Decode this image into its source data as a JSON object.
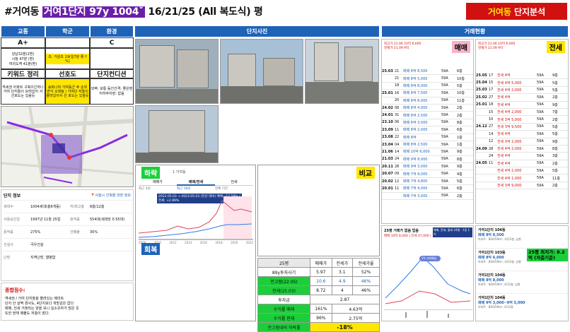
{
  "header": {
    "title_prefix": "#거여동",
    "title_highlight": "거여1단지 97y 1004ˇ",
    "title_suffix": "16/21/25 (All 복도식) 평",
    "brand_yellow": "거여동",
    "brand_white": "단지분석"
  },
  "left": {
    "col_headers": [
      "교통",
      "학군",
      "환경"
    ],
    "grades": [
      "A+",
      "",
      "C"
    ],
    "transport_lines": [
      "강남32분(2환)",
      "시청 47분 (환)",
      "여의도역 41분(환)"
    ],
    "school_note": "초: 거원초 19(일7분 좋:?%)",
    "keyword_title": "키워드 정리",
    "seon_title": "선호도",
    "cond_title": "단지컨디션",
    "keyword_text": "역세권 아파트 구축이긴하나 거여 단지들이 모여있어 서 선호도는 있음듯",
    "seon_text": "송파나위 거여동군 후 순위 면식 오래됨 / 거여단 저들이 몰려있어서 선 호도는 있을듯",
    "cond_text": "외벽: 보통 동간간격: 좋은편 지하주차장: 없음",
    "info_title": "단지 정보",
    "info_link": "서울시 건축물 대장 정보",
    "info_rows": [
      [
        "세대수",
        "1004세대(총6개동)",
        "저/최고층",
        "8층/12층"
      ],
      [
        "사용승인일",
        "1997년 11월 25일",
        "용적률",
        "554대(세대당 0.55대)"
      ],
      [
        "용적률",
        "275%",
        "건폐율",
        "30%"
      ],
      [
        "건설사",
        "극우건설",
        "",
        ""
      ],
      [
        "난방",
        "지역난방, 열병합",
        "",
        ""
      ]
    ],
    "summary_title": "종합점수:",
    "summary_lines": [
      "역세권 / 거여 단지들을 몰려있는 메리트",
      "단지 안 살짝 경사도, 4단지보다 개방감은 없다",
      "매매, 전세 거래되는 양을 보니 실소유자가 많은 듯",
      "또한 현재 매물도 저층이 많다."
    ]
  },
  "middle": {
    "title": "단지사진",
    "down_label": "하락",
    "up_label": "회복",
    "compare_label": "비교",
    "chart_title": "1 거여동",
    "chart_tabs": [
      "매매가",
      "매매/전세",
      "전세"
    ],
    "chart_periods": [
      "최근 3년",
      "최근 10년",
      "전체 기간"
    ],
    "chart_note": "2022.05.03 → 2023.05.03 (전년 대비) 매매: -17.59% / 전세: +2.89%",
    "chart_xlabels": [
      "2008",
      "2010",
      "2012",
      "2014",
      "2016",
      "2018",
      "2020",
      "2022"
    ]
  },
  "table": {
    "headers": [
      "25평",
      "매매가",
      "전세가",
      "전세가율"
    ],
    "rows": [
      [
        "89y투자사기",
        "5.97",
        "3.1",
        "52%"
      ],
      [
        "전고점(22.05)",
        "10.6",
        "4.9",
        "46%"
      ],
      [
        "현재(25.03)",
        "8.72",
        "4",
        "46%"
      ],
      [
        "투자금",
        "",
        "2.87",
        ""
      ],
      [
        "수익률 매매",
        "161%",
        "",
        "4.63억"
      ],
      [
        "수익률 현재",
        "96%",
        "",
        "2.75억"
      ],
      [
        "전고점대비 하락률",
        "",
        "-18%",
        ""
      ]
    ]
  },
  "right": {
    "title": "거래현황",
    "sale_label": "매매",
    "jeonse_label": "전세",
    "sale_box": [
      "최고가 21.06 10억 6,000",
      "현재가 21.09 9억"
    ],
    "jeonse_box": [
      "최고가 21.06 10억 6,000",
      "현재가 21.09 9억"
    ],
    "sale_rows": [
      [
        "25.03",
        "21",
        "매매 8억 8,500",
        "59A",
        "6층"
      ],
      [
        "",
        "21",
        "매매 8억 5,000",
        "59A",
        "10층"
      ],
      [
        "",
        "18",
        "매매 8억 8,000",
        "59A",
        "5층"
      ],
      [
        "25.01",
        "16",
        "매매 8억 7,500",
        "59A",
        "10층"
      ],
      [
        "",
        "20",
        "매매 8억 8,000",
        "59A",
        "11층"
      ],
      [
        "24.02",
        "06",
        "매매 8억 4,000",
        "59A",
        "2층"
      ],
      [
        "24.01",
        "31",
        "매매 8억 2,500",
        "59A",
        "2층"
      ],
      [
        "23.10",
        "06",
        "매매 8억 3,000",
        "59A",
        "8층"
      ],
      [
        "23.09",
        "11",
        "매매 8억 2,000",
        "59A",
        "6층"
      ],
      [
        "23.08",
        "22",
        "매매 8억",
        "59A",
        "1층"
      ],
      [
        "23.04",
        "04",
        "매매 8억 2,500",
        "59A",
        "1층"
      ],
      [
        "21.06",
        "14",
        "매매 10억 6,000",
        "59A",
        "9층"
      ],
      [
        "21.03",
        "24",
        "매매 9억 8,000",
        "59A",
        "8층"
      ],
      [
        "20.11",
        "28",
        "매매 9억 3,000",
        "59A",
        "9층"
      ],
      [
        "20.07",
        "09",
        "매매 7억 9,000",
        "59A",
        "4층"
      ],
      [
        "20.02",
        "12",
        "매매 7억 4,800",
        "59A",
        "5층"
      ],
      [
        "20.01",
        "11",
        "매매 7억 4,000",
        "59A",
        "6층"
      ],
      [
        "",
        "",
        "매매 7억 3,000",
        "59A",
        "2층"
      ]
    ],
    "jeonse_rows": [
      [
        "25.05",
        "17",
        "전세 4억",
        "59A",
        "9층"
      ],
      [
        "25.04",
        "15",
        "전세 4억 5,000",
        "59A",
        "5층"
      ],
      [
        "25.03",
        "17",
        "전세 4억 2,000",
        "59A",
        "5층"
      ],
      [
        "25.02",
        "27",
        "전세 4억",
        "59A",
        "2층"
      ],
      [
        "25.01",
        "18",
        "전세 4억",
        "59A",
        "9층"
      ],
      [
        "",
        "15",
        "전세 4억 2,000",
        "59A",
        "7층"
      ],
      [
        "",
        "10",
        "전세 3억 5,000",
        "59A",
        "2층"
      ],
      [
        "24.12",
        "27",
        "전세 3억 9,500",
        "59A",
        "5층"
      ],
      [
        "",
        "14",
        "전세 4억",
        "59A",
        "5층"
      ],
      [
        "",
        "12",
        "전세 3억 2,000",
        "59A",
        "9층"
      ],
      [
        "24.09",
        "28",
        "전세 4억 2,000",
        "59A",
        "8층"
      ],
      [
        "",
        "24",
        "전세 4억",
        "59A",
        "3층"
      ],
      [
        "24.05",
        "11",
        "전세 4억",
        "59A",
        "2층"
      ],
      [
        "",
        "",
        "전세 4억 2,000",
        "59A",
        "5층"
      ],
      [
        "",
        "",
        "전세 4억 1,000",
        "59A",
        "11층"
      ],
      [
        "",
        "",
        "전세 3억 9,000",
        "59A",
        "2층"
      ]
    ],
    "listing_header": "25평 거래가 없음 업음",
    "listing_sub": "매매 10억 6,000 | 전세 47,000 / 1건",
    "listing_badge": "VS 거래예상",
    "listing_tag": "매매, 전세, 월세 24평 · 1동 1이",
    "listings": [
      {
        "title": "거여1단지 106동",
        "price": "매매 8억 8,500",
        "meta": "아파트 · 84A/59m², 저/12층, 남향"
      },
      {
        "title": "거여1단지 103동",
        "price": "매매 8억 6,000",
        "meta": "아파트 · 84A/59m², 저/12층, 남향"
      },
      {
        "title": "거여1단지 104동",
        "price": "매매 8억 8,000",
        "meta": "아파트 · 84A/59m², 4/12층, 남향"
      },
      {
        "title": "거여1단지 104동",
        "price": "매매 9억 3,000~9억 5,000",
        "meta": "아파트 · 84A/59m², 4/12층"
      }
    ],
    "listing_callout": "25평 최저가: 8.2억 (저층기준)"
  },
  "colors": {
    "accent": "#1f63b8",
    "brand": "#d11010",
    "title_hl": "#6b1fa8",
    "tag_green": "#1ccf3a",
    "tag_yellow": "#ffe600",
    "tag_blue": "#1f63b8"
  }
}
